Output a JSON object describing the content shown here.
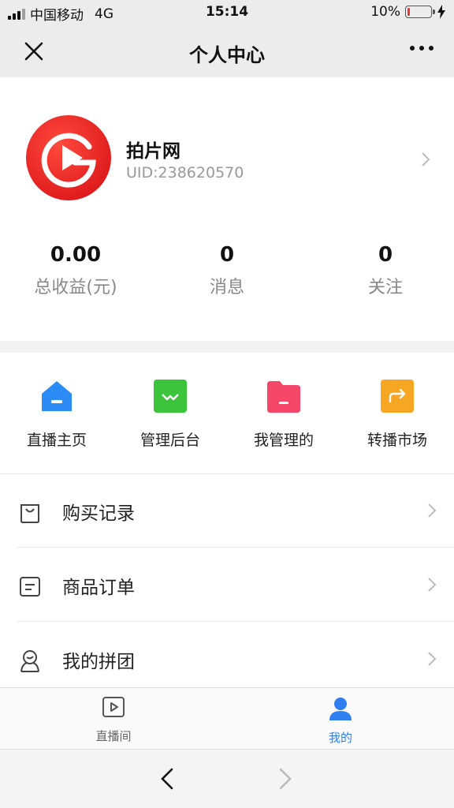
{
  "status_bar": {
    "carrier": "中国移动",
    "network": "4G",
    "time": "15:14",
    "battery_percent": "10%",
    "battery_level": 0.1
  },
  "nav": {
    "title": "个人中心",
    "close_icon": "close-icon",
    "more_icon": "more-icon"
  },
  "profile": {
    "name": "拍片网",
    "uid": "UID:238620570",
    "avatar_color": "#e8221f"
  },
  "stats": [
    {
      "value": "0.00",
      "label": "总收益(元)"
    },
    {
      "value": "0",
      "label": "消息"
    },
    {
      "value": "0",
      "label": "关注"
    }
  ],
  "grid": [
    {
      "label": "直播主页",
      "icon": "home-icon",
      "color": "#2b8cf6"
    },
    {
      "label": "管理后台",
      "icon": "dashboard-icon",
      "color": "#3cc43c"
    },
    {
      "label": "我管理的",
      "icon": "folder-icon",
      "color": "#f5476a"
    },
    {
      "label": "转播市场",
      "icon": "share-icon",
      "color": "#f5a623"
    }
  ],
  "list": [
    {
      "label": "购买记录",
      "icon": "shopping-bag-icon"
    },
    {
      "label": "商品订单",
      "icon": "order-icon"
    },
    {
      "label": "我的拼团",
      "icon": "group-buy-icon"
    }
  ],
  "tabbar": [
    {
      "label": "直播间",
      "icon": "play-box-icon",
      "active": false
    },
    {
      "label": "我的",
      "icon": "user-icon",
      "active": true
    }
  ],
  "colors": {
    "active_tab": "#2f7ff0",
    "inactive_tab": "#666666"
  }
}
